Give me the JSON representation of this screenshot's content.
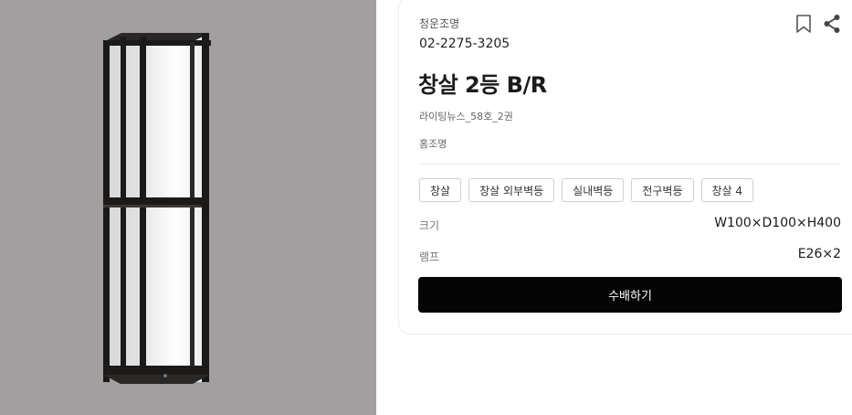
{
  "product": {
    "brand": "청운조명",
    "phone": "02-2275-3205",
    "title": "창살 2등 B/R",
    "source": "라이팅뉴스_58호_2권",
    "category": "홈조명"
  },
  "tags": [
    "창살",
    "창살 외부벽등",
    "실내벽등",
    "전구벽등",
    "창살 4"
  ],
  "specs": [
    {
      "label": "크기",
      "value": "W100×D100×H400"
    },
    {
      "label": "램프",
      "value": "E26×2"
    }
  ],
  "actions": {
    "order_label": "수배하기",
    "bookmark_icon": "bookmark-icon",
    "share_icon": "share-icon"
  },
  "colors": {
    "image_background": "#a19fa0",
    "button_background": "#050505",
    "lamp_frame": "#1c1a19"
  }
}
